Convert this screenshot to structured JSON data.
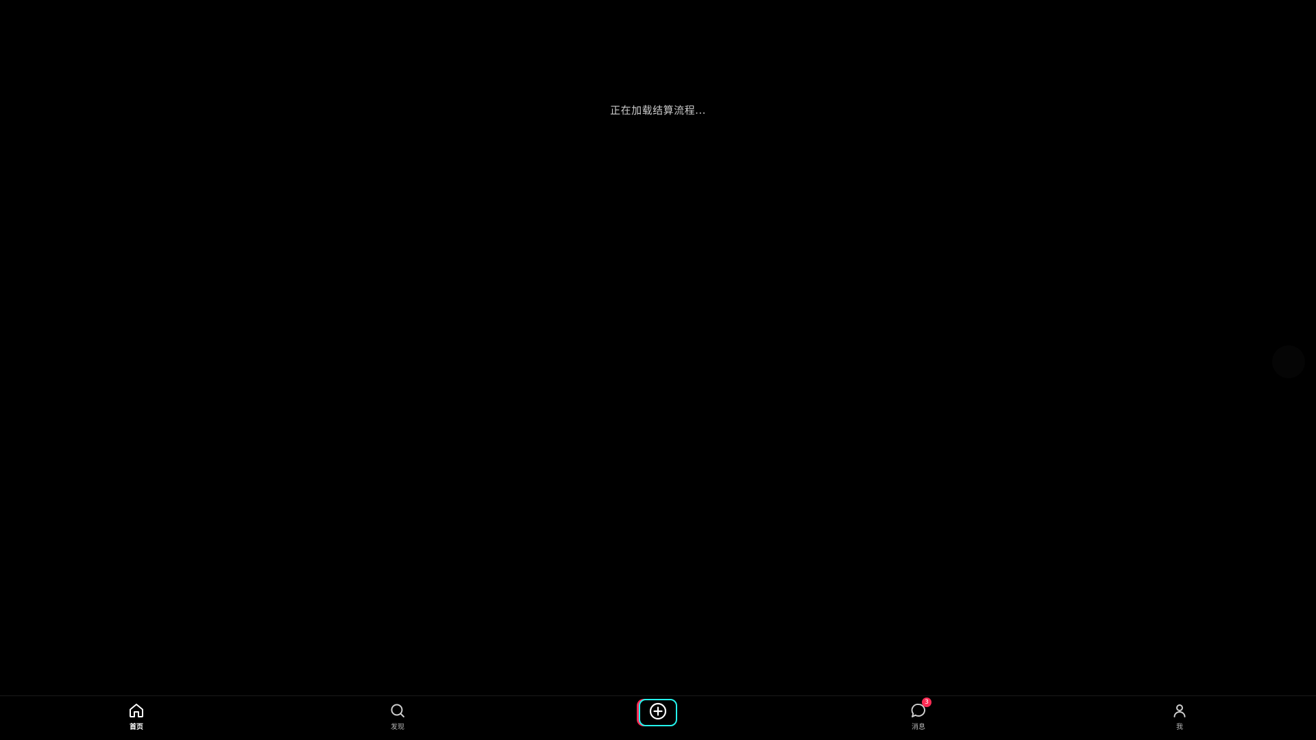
{
  "loading": {
    "text": "正在加载结算流程..."
  },
  "tabbar": {
    "items": [
      {
        "label": "首页",
        "icon": "home-icon",
        "active": true
      },
      {
        "label": "发现",
        "icon": "search-icon",
        "active": false
      },
      {
        "label": "",
        "icon": "plus-circle-icon",
        "active": false
      },
      {
        "label": "消息",
        "icon": "chat-bubble-icon",
        "active": false,
        "badge": "3"
      },
      {
        "label": "我",
        "icon": "user-icon",
        "active": false
      }
    ]
  },
  "colors": {
    "background": "#000000",
    "badge": "#fe2c55",
    "accent_cyan": "#25f4ee",
    "accent_pink": "#fe2c55"
  }
}
